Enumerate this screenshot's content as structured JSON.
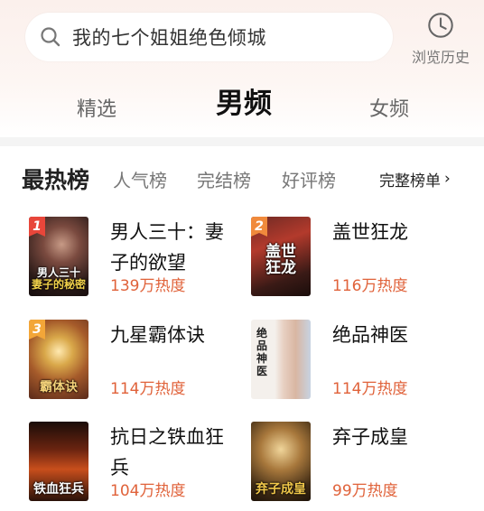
{
  "search": {
    "value": "我的七个姐姐绝色倾城"
  },
  "history": {
    "label": "浏览历史",
    "icon": "clock-icon"
  },
  "channel_tabs": [
    {
      "label": "精选",
      "active": false
    },
    {
      "label": "男频",
      "active": true
    },
    {
      "label": "女频",
      "active": false
    }
  ],
  "rank_tabs": [
    {
      "label": "最热榜",
      "active": true
    },
    {
      "label": "人气榜",
      "active": false
    },
    {
      "label": "完结榜",
      "active": false
    },
    {
      "label": "好评榜",
      "active": false
    }
  ],
  "full_list": {
    "label": "完整榜单",
    "icon": "chevron-right-icon"
  },
  "books": [
    {
      "rank": "1",
      "title": "男人三十：妻子的欲望",
      "heat": "139万热度",
      "badge_color": "#e8463a"
    },
    {
      "rank": "2",
      "title": "盖世狂龙",
      "heat": "116万热度",
      "badge_color": "#f08a3c"
    },
    {
      "rank": "3",
      "title": "九星霸体诀",
      "heat": "114万热度",
      "badge_color": "#f3a638"
    },
    {
      "rank": "",
      "title": "绝品神医",
      "heat": "114万热度"
    },
    {
      "rank": "",
      "title": "抗日之铁血狂兵",
      "heat": "104万热度"
    },
    {
      "rank": "",
      "title": "弃子成皇",
      "heat": "99万热度"
    }
  ],
  "colors": {
    "accent": "#e0623a",
    "top_bg": "#fbf0ec"
  }
}
